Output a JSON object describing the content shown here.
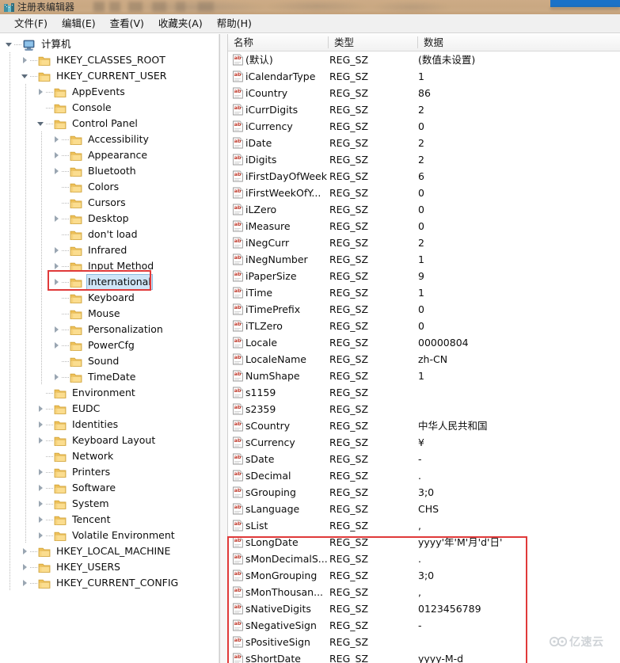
{
  "window": {
    "title": "注册表编辑器",
    "icon": "registry-editor-icon"
  },
  "menu": {
    "items": [
      {
        "label": "文件(F)",
        "name": "file"
      },
      {
        "label": "编辑(E)",
        "name": "edit"
      },
      {
        "label": "查看(V)",
        "name": "view"
      },
      {
        "label": "收藏夹(A)",
        "name": "favorites"
      },
      {
        "label": "帮助(H)",
        "name": "help"
      }
    ]
  },
  "tree": {
    "nodes": [
      {
        "label": "计算机",
        "depth": 0,
        "twist": "open",
        "icon": "computer-icon",
        "selected": false
      },
      {
        "label": "HKEY_CLASSES_ROOT",
        "depth": 1,
        "twist": "closed",
        "icon": "folder-icon",
        "selected": false
      },
      {
        "label": "HKEY_CURRENT_USER",
        "depth": 1,
        "twist": "open",
        "icon": "folder-icon",
        "selected": false
      },
      {
        "label": "AppEvents",
        "depth": 2,
        "twist": "closed",
        "icon": "folder-icon",
        "selected": false
      },
      {
        "label": "Console",
        "depth": 2,
        "twist": "none",
        "icon": "folder-icon",
        "selected": false
      },
      {
        "label": "Control Panel",
        "depth": 2,
        "twist": "open",
        "icon": "folder-icon",
        "selected": false
      },
      {
        "label": "Accessibility",
        "depth": 3,
        "twist": "closed",
        "icon": "folder-icon",
        "selected": false
      },
      {
        "label": "Appearance",
        "depth": 3,
        "twist": "closed",
        "icon": "folder-icon",
        "selected": false
      },
      {
        "label": "Bluetooth",
        "depth": 3,
        "twist": "closed",
        "icon": "folder-icon",
        "selected": false
      },
      {
        "label": "Colors",
        "depth": 3,
        "twist": "none",
        "icon": "folder-icon",
        "selected": false
      },
      {
        "label": "Cursors",
        "depth": 3,
        "twist": "none",
        "icon": "folder-icon",
        "selected": false
      },
      {
        "label": "Desktop",
        "depth": 3,
        "twist": "closed",
        "icon": "folder-icon",
        "selected": false
      },
      {
        "label": "don't load",
        "depth": 3,
        "twist": "none",
        "icon": "folder-icon",
        "selected": false
      },
      {
        "label": "Infrared",
        "depth": 3,
        "twist": "closed",
        "icon": "folder-icon",
        "selected": false
      },
      {
        "label": "Input Method",
        "depth": 3,
        "twist": "closed",
        "icon": "folder-icon",
        "selected": false
      },
      {
        "label": "International",
        "depth": 3,
        "twist": "closed",
        "icon": "folder-icon",
        "selected": true
      },
      {
        "label": "Keyboard",
        "depth": 3,
        "twist": "none",
        "icon": "folder-icon",
        "selected": false
      },
      {
        "label": "Mouse",
        "depth": 3,
        "twist": "none",
        "icon": "folder-icon",
        "selected": false
      },
      {
        "label": "Personalization",
        "depth": 3,
        "twist": "closed",
        "icon": "folder-icon",
        "selected": false
      },
      {
        "label": "PowerCfg",
        "depth": 3,
        "twist": "closed",
        "icon": "folder-icon",
        "selected": false
      },
      {
        "label": "Sound",
        "depth": 3,
        "twist": "none",
        "icon": "folder-icon",
        "selected": false
      },
      {
        "label": "TimeDate",
        "depth": 3,
        "twist": "closed",
        "icon": "folder-icon",
        "selected": false
      },
      {
        "label": "Environment",
        "depth": 2,
        "twist": "none",
        "icon": "folder-icon",
        "selected": false
      },
      {
        "label": "EUDC",
        "depth": 2,
        "twist": "closed",
        "icon": "folder-icon",
        "selected": false
      },
      {
        "label": "Identities",
        "depth": 2,
        "twist": "closed",
        "icon": "folder-icon",
        "selected": false
      },
      {
        "label": "Keyboard Layout",
        "depth": 2,
        "twist": "closed",
        "icon": "folder-icon",
        "selected": false
      },
      {
        "label": "Network",
        "depth": 2,
        "twist": "none",
        "icon": "folder-icon",
        "selected": false
      },
      {
        "label": "Printers",
        "depth": 2,
        "twist": "closed",
        "icon": "folder-icon",
        "selected": false
      },
      {
        "label": "Software",
        "depth": 2,
        "twist": "closed",
        "icon": "folder-icon",
        "selected": false
      },
      {
        "label": "System",
        "depth": 2,
        "twist": "closed",
        "icon": "folder-icon",
        "selected": false
      },
      {
        "label": "Tencent",
        "depth": 2,
        "twist": "closed",
        "icon": "folder-icon",
        "selected": false
      },
      {
        "label": "Volatile Environment",
        "depth": 2,
        "twist": "closed",
        "icon": "folder-icon",
        "selected": false
      },
      {
        "label": "HKEY_LOCAL_MACHINE",
        "depth": 1,
        "twist": "closed",
        "icon": "folder-icon",
        "selected": false
      },
      {
        "label": "HKEY_USERS",
        "depth": 1,
        "twist": "closed",
        "icon": "folder-icon",
        "selected": false
      },
      {
        "label": "HKEY_CURRENT_CONFIG",
        "depth": 1,
        "twist": "closed",
        "icon": "folder-icon",
        "selected": false
      }
    ]
  },
  "list": {
    "columns": [
      {
        "label": "名称",
        "name": "name"
      },
      {
        "label": "类型",
        "name": "type"
      },
      {
        "label": "数据",
        "name": "data"
      }
    ],
    "rows": [
      {
        "name": "(默认)",
        "type": "REG_SZ",
        "data": "(数值未设置)",
        "icon": "string-value-icon"
      },
      {
        "name": "iCalendarType",
        "type": "REG_SZ",
        "data": "1",
        "icon": "string-value-icon"
      },
      {
        "name": "iCountry",
        "type": "REG_SZ",
        "data": "86",
        "icon": "string-value-icon"
      },
      {
        "name": "iCurrDigits",
        "type": "REG_SZ",
        "data": "2",
        "icon": "string-value-icon"
      },
      {
        "name": "iCurrency",
        "type": "REG_SZ",
        "data": "0",
        "icon": "string-value-icon"
      },
      {
        "name": "iDate",
        "type": "REG_SZ",
        "data": "2",
        "icon": "string-value-icon"
      },
      {
        "name": "iDigits",
        "type": "REG_SZ",
        "data": "2",
        "icon": "string-value-icon"
      },
      {
        "name": "iFirstDayOfWeek",
        "type": "REG_SZ",
        "data": "6",
        "icon": "string-value-icon"
      },
      {
        "name": "iFirstWeekOfY...",
        "type": "REG_SZ",
        "data": "0",
        "icon": "string-value-icon"
      },
      {
        "name": "iLZero",
        "type": "REG_SZ",
        "data": "0",
        "icon": "string-value-icon"
      },
      {
        "name": "iMeasure",
        "type": "REG_SZ",
        "data": "0",
        "icon": "string-value-icon"
      },
      {
        "name": "iNegCurr",
        "type": "REG_SZ",
        "data": "2",
        "icon": "string-value-icon"
      },
      {
        "name": "iNegNumber",
        "type": "REG_SZ",
        "data": "1",
        "icon": "string-value-icon"
      },
      {
        "name": "iPaperSize",
        "type": "REG_SZ",
        "data": "9",
        "icon": "string-value-icon"
      },
      {
        "name": "iTime",
        "type": "REG_SZ",
        "data": "1",
        "icon": "string-value-icon"
      },
      {
        "name": "iTimePrefix",
        "type": "REG_SZ",
        "data": "0",
        "icon": "string-value-icon"
      },
      {
        "name": "iTLZero",
        "type": "REG_SZ",
        "data": "0",
        "icon": "string-value-icon"
      },
      {
        "name": "Locale",
        "type": "REG_SZ",
        "data": "00000804",
        "icon": "string-value-icon"
      },
      {
        "name": "LocaleName",
        "type": "REG_SZ",
        "data": "zh-CN",
        "icon": "string-value-icon"
      },
      {
        "name": "NumShape",
        "type": "REG_SZ",
        "data": "1",
        "icon": "string-value-icon"
      },
      {
        "name": "s1159",
        "type": "REG_SZ",
        "data": "",
        "icon": "string-value-icon"
      },
      {
        "name": "s2359",
        "type": "REG_SZ",
        "data": "",
        "icon": "string-value-icon"
      },
      {
        "name": "sCountry",
        "type": "REG_SZ",
        "data": "中华人民共和国",
        "icon": "string-value-icon"
      },
      {
        "name": "sCurrency",
        "type": "REG_SZ",
        "data": "¥",
        "icon": "string-value-icon"
      },
      {
        "name": "sDate",
        "type": "REG_SZ",
        "data": "-",
        "icon": "string-value-icon"
      },
      {
        "name": "sDecimal",
        "type": "REG_SZ",
        "data": ".",
        "icon": "string-value-icon"
      },
      {
        "name": "sGrouping",
        "type": "REG_SZ",
        "data": "3;0",
        "icon": "string-value-icon"
      },
      {
        "name": "sLanguage",
        "type": "REG_SZ",
        "data": "CHS",
        "icon": "string-value-icon"
      },
      {
        "name": "sList",
        "type": "REG_SZ",
        "data": ",",
        "icon": "string-value-icon"
      },
      {
        "name": "sLongDate",
        "type": "REG_SZ",
        "data": "yyyy'年'M'月'd'日'",
        "icon": "string-value-icon"
      },
      {
        "name": "sMonDecimalS...",
        "type": "REG_SZ",
        "data": ".",
        "icon": "string-value-icon"
      },
      {
        "name": "sMonGrouping",
        "type": "REG_SZ",
        "data": "3;0",
        "icon": "string-value-icon"
      },
      {
        "name": "sMonThousan...",
        "type": "REG_SZ",
        "data": ",",
        "icon": "string-value-icon"
      },
      {
        "name": "sNativeDigits",
        "type": "REG_SZ",
        "data": "0123456789",
        "icon": "string-value-icon"
      },
      {
        "name": "sNegativeSign",
        "type": "REG_SZ",
        "data": "-",
        "icon": "string-value-icon"
      },
      {
        "name": "sPositiveSign",
        "type": "REG_SZ",
        "data": "",
        "icon": "string-value-icon"
      },
      {
        "name": "sShortDate",
        "type": "REG_SZ",
        "data": "yyyy-M-d",
        "icon": "string-value-icon"
      }
    ]
  },
  "annotations": {
    "color": "#e03a3a",
    "tree_highlight": "International",
    "list_highlight_start": "sLongDate"
  },
  "watermark": {
    "text": "亿速云"
  }
}
